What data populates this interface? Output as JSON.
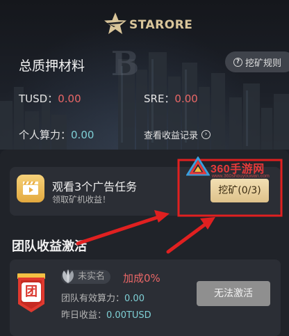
{
  "header": {
    "brand": "STARORE",
    "title": "总质押材料",
    "rules_label": "挖矿规则",
    "tusd_label": "TUSD：",
    "tusd_value": "0.00",
    "sre_label": "SRE：",
    "sre_value": "0.00",
    "power_label": "个人算力：",
    "power_value": "0.00",
    "records_label": "查看收益记录"
  },
  "task": {
    "title": "观看3个广告任务",
    "subtitle": "领取矿机收益！",
    "button_label": "挖矿(0/3)"
  },
  "team": {
    "section_title": "团队收益激活",
    "badge_char": "团",
    "verify_status": "未实名",
    "bonus": "加成0%",
    "power_label": "团队有效算力：",
    "power_value": "0.00",
    "yesterday_label": "昨日收益：",
    "yesterday_value": "0.00TUSD",
    "activate_label": "无法激活"
  },
  "watermark": {
    "site": "360手游网",
    "url": "www.360shouyouwan.com"
  },
  "colors": {
    "accent_gold": "#dec28b",
    "value_red": "#ea6767",
    "value_teal": "#7fd0d6",
    "badge_red": "#d9342b",
    "annotation_red": "#e02020"
  },
  "icons": [
    "starore-logo-icon",
    "question-icon",
    "chevron-right-icon",
    "video-clapper-icon",
    "team-badge-icon",
    "leaf-icon",
    "arrow-annotation-icon"
  ]
}
